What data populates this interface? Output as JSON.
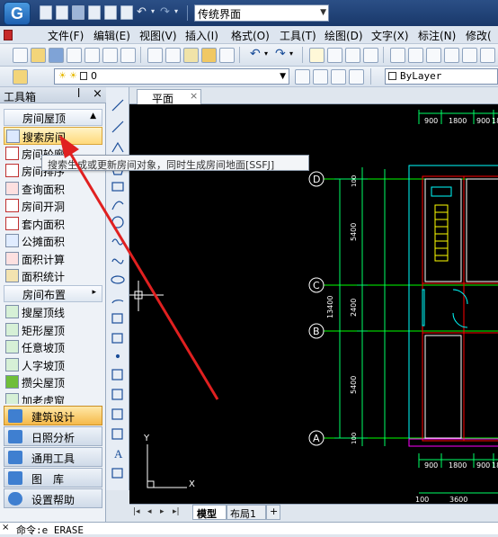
{
  "title_bar": {
    "logo_letter": "G",
    "workspace_value": "传统界面"
  },
  "menu": {
    "items": [
      "文件(F)",
      "编辑(E)",
      "视图(V)",
      "插入(I)",
      "格式(O)",
      "工具(T)",
      "绘图(D)",
      "文字(X)",
      "标注(N)",
      "修改("
    ]
  },
  "toolbar2": {
    "layer_value": "0",
    "linetype_value": "ByLayer"
  },
  "toolbox": {
    "title": "工具箱",
    "pin": "ⴲ",
    "close": "×",
    "category_top": "房间屋顶",
    "items": [
      "搜索房间",
      "房间轮廓",
      "房间排序",
      "查询面积",
      "房间开洞",
      "套内面积",
      "公摊面积",
      "面积计算",
      "面积统计"
    ],
    "category_mid": "房间布置",
    "items2": [
      "搜屋顶线",
      "矩形屋顶",
      "任意坡顶",
      "人字坡顶",
      "攒尖屋顶",
      "加老虎窗"
    ],
    "big_buttons": [
      "建筑设计",
      "日照分析",
      "通用工具",
      "图　库",
      "设置帮助"
    ]
  },
  "tooltip": {
    "text": "搜索生成或更新房间对象，同时生成房间地面[SSFJ]"
  },
  "drawing": {
    "tab_label": "平面",
    "tab_close": "×",
    "axis_labels": [
      "D",
      "C",
      "B",
      "A"
    ],
    "vertical_dims": [
      "5400",
      "2400",
      "5400",
      "13400",
      "100",
      "100"
    ],
    "top_dims": [
      "900",
      "1800",
      "900",
      "18"
    ],
    "bottom_dims": [
      "900",
      "1800",
      "900",
      "18",
      "100",
      "3600"
    ],
    "ucs_y": "Y",
    "ucs_x": "X",
    "colors": {
      "axis": "#00ff00",
      "wall": "#ff0000",
      "dim": "#00ff66",
      "cyan": "#00ffff",
      "yellow": "#ffff00",
      "magenta": "#ff00ff"
    }
  },
  "layout_tabs": {
    "model": "模型",
    "layout1": "布局1",
    "add": "+"
  },
  "command": {
    "close": "×",
    "text": "命令:e ERASE"
  }
}
